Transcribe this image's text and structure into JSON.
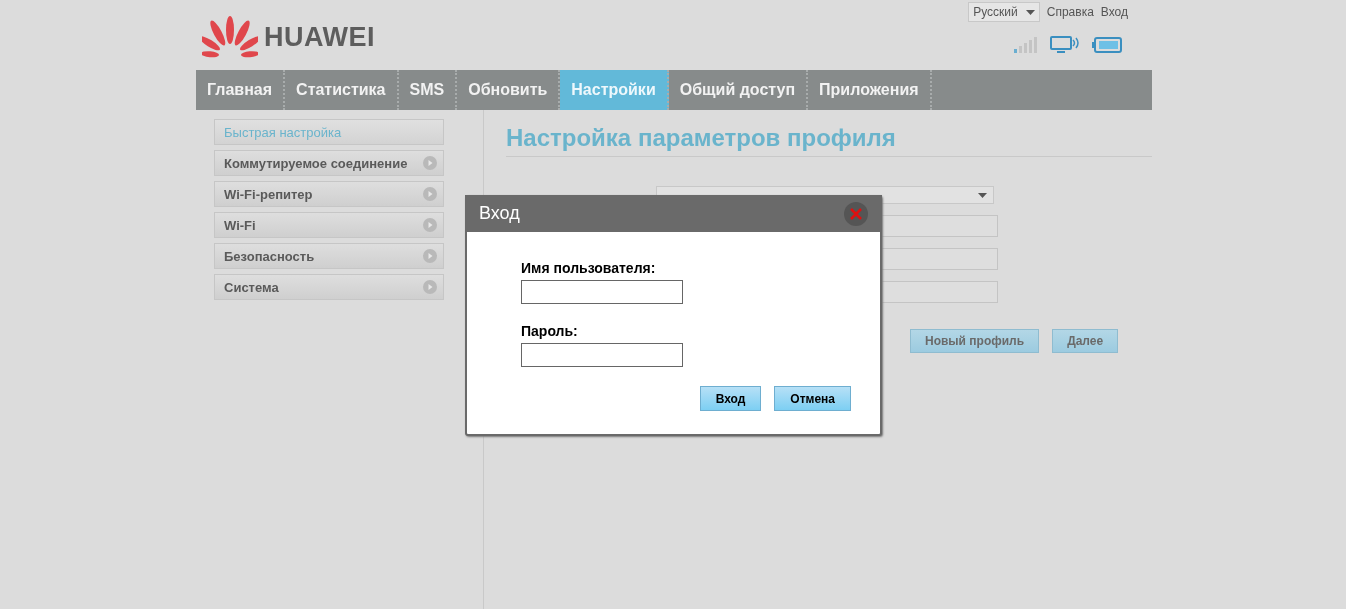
{
  "header": {
    "brand": "HUAWEI",
    "language": "Русский",
    "links": [
      "Справка",
      "Вход"
    ]
  },
  "nav": [
    {
      "label": "Главная",
      "selected": false
    },
    {
      "label": "Статистика",
      "selected": false
    },
    {
      "label": "SMS",
      "selected": false
    },
    {
      "label": "Обновить",
      "selected": false
    },
    {
      "label": "Настройки",
      "selected": true
    },
    {
      "label": "Общий доступ",
      "selected": false
    },
    {
      "label": "Приложения",
      "selected": false
    }
  ],
  "sidebar": {
    "items": [
      {
        "label": "Быстрая настройка",
        "selected": true
      },
      {
        "label": "Коммутируемое соединение",
        "selected": false
      },
      {
        "label": "Wi-Fi-репитер",
        "selected": false
      },
      {
        "label": "Wi-Fi",
        "selected": false
      },
      {
        "label": "Безопасность",
        "selected": false
      },
      {
        "label": "Система",
        "selected": false
      }
    ]
  },
  "page": {
    "title": "Настройка параметров профиля",
    "buttons": [
      "Новый профиль",
      "Далее"
    ]
  },
  "dialog": {
    "title": "Вход",
    "fields": [
      {
        "label": "Имя пользователя:"
      },
      {
        "label": "Пароль:"
      }
    ],
    "buttons": [
      "Вход",
      "Отмена"
    ]
  }
}
